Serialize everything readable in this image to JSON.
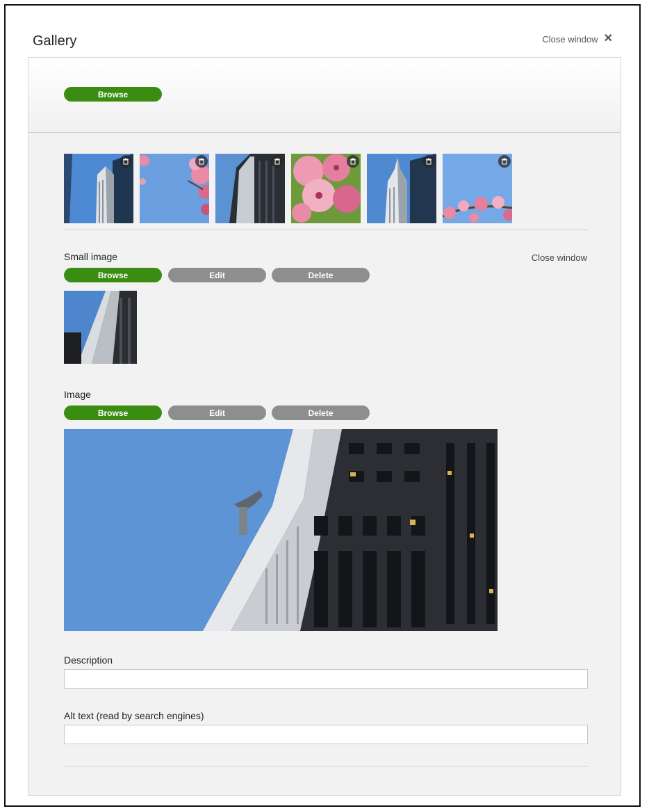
{
  "header": {
    "title": "Gallery",
    "close_label": "Close window",
    "close_glyph": "✕"
  },
  "top_bar": {
    "browse_label": "Browse"
  },
  "thumbnails": [
    {
      "subject": "skyscraper",
      "icon": "trash-icon"
    },
    {
      "subject": "cherry-blossom-sky",
      "icon": "trash-icon"
    },
    {
      "subject": "skyscraper-dark",
      "icon": "trash-icon"
    },
    {
      "subject": "cherry-blossom-closeup",
      "icon": "trash-icon"
    },
    {
      "subject": "skyscraper-spire",
      "icon": "trash-icon"
    },
    {
      "subject": "cherry-blossom-branch",
      "icon": "trash-icon"
    }
  ],
  "small_image": {
    "label": "Small image",
    "close_label": "Close window",
    "browse_label": "Browse",
    "edit_label": "Edit",
    "delete_label": "Delete"
  },
  "image": {
    "label": "Image",
    "browse_label": "Browse",
    "edit_label": "Edit",
    "delete_label": "Delete"
  },
  "description": {
    "label": "Description",
    "value": "",
    "placeholder": ""
  },
  "alt_text": {
    "label": "Alt text (read by search engines)",
    "value": "",
    "placeholder": ""
  },
  "colors": {
    "accent_green": "#3b8d12",
    "button_grey": "#8e8e8e",
    "panel_bg": "#f2f2f2",
    "sky_blue": "#5d94d6"
  }
}
